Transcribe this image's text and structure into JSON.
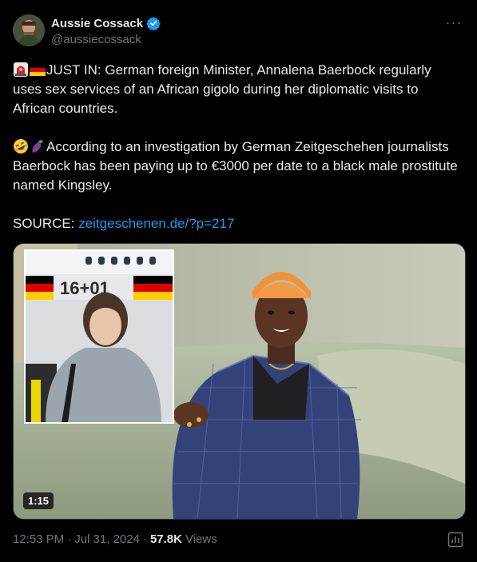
{
  "author": {
    "display_name": "Aussie Cossack",
    "handle": "@aussiecossack",
    "verified": true
  },
  "more_label": "···",
  "tweet": {
    "paragraph1": "JUST IN: German foreign Minister, Annalena Baerbock regularly uses sex services of an African gigolo during her diplomatic visits to African countries.",
    "paragraph2": "According to an investigation by German Zeitgeschehen journalists Baerbock has been paying up to €3000 per date to a black male prostitute named Kingsley.",
    "source_label": "SOURCE:",
    "source_link": "zeitgeschenen.de/?p=217"
  },
  "media": {
    "duration": "1:15",
    "plane_marking": "16+01"
  },
  "meta": {
    "time": "12:53 PM",
    "separator": "·",
    "date": "Jul 31, 2024",
    "views_count": "57.8K",
    "views_label": "Views"
  },
  "colors": {
    "background": "#000000",
    "text": "#e7e9ea",
    "muted": "#71767b",
    "link": "#1d9bf0",
    "verified": "#1d9bf0"
  },
  "icons": [
    "siren-emoji",
    "germany-flag-emoji",
    "rofl-emoji",
    "eggplant-emoji",
    "verified-badge-icon",
    "analytics-icon"
  ]
}
